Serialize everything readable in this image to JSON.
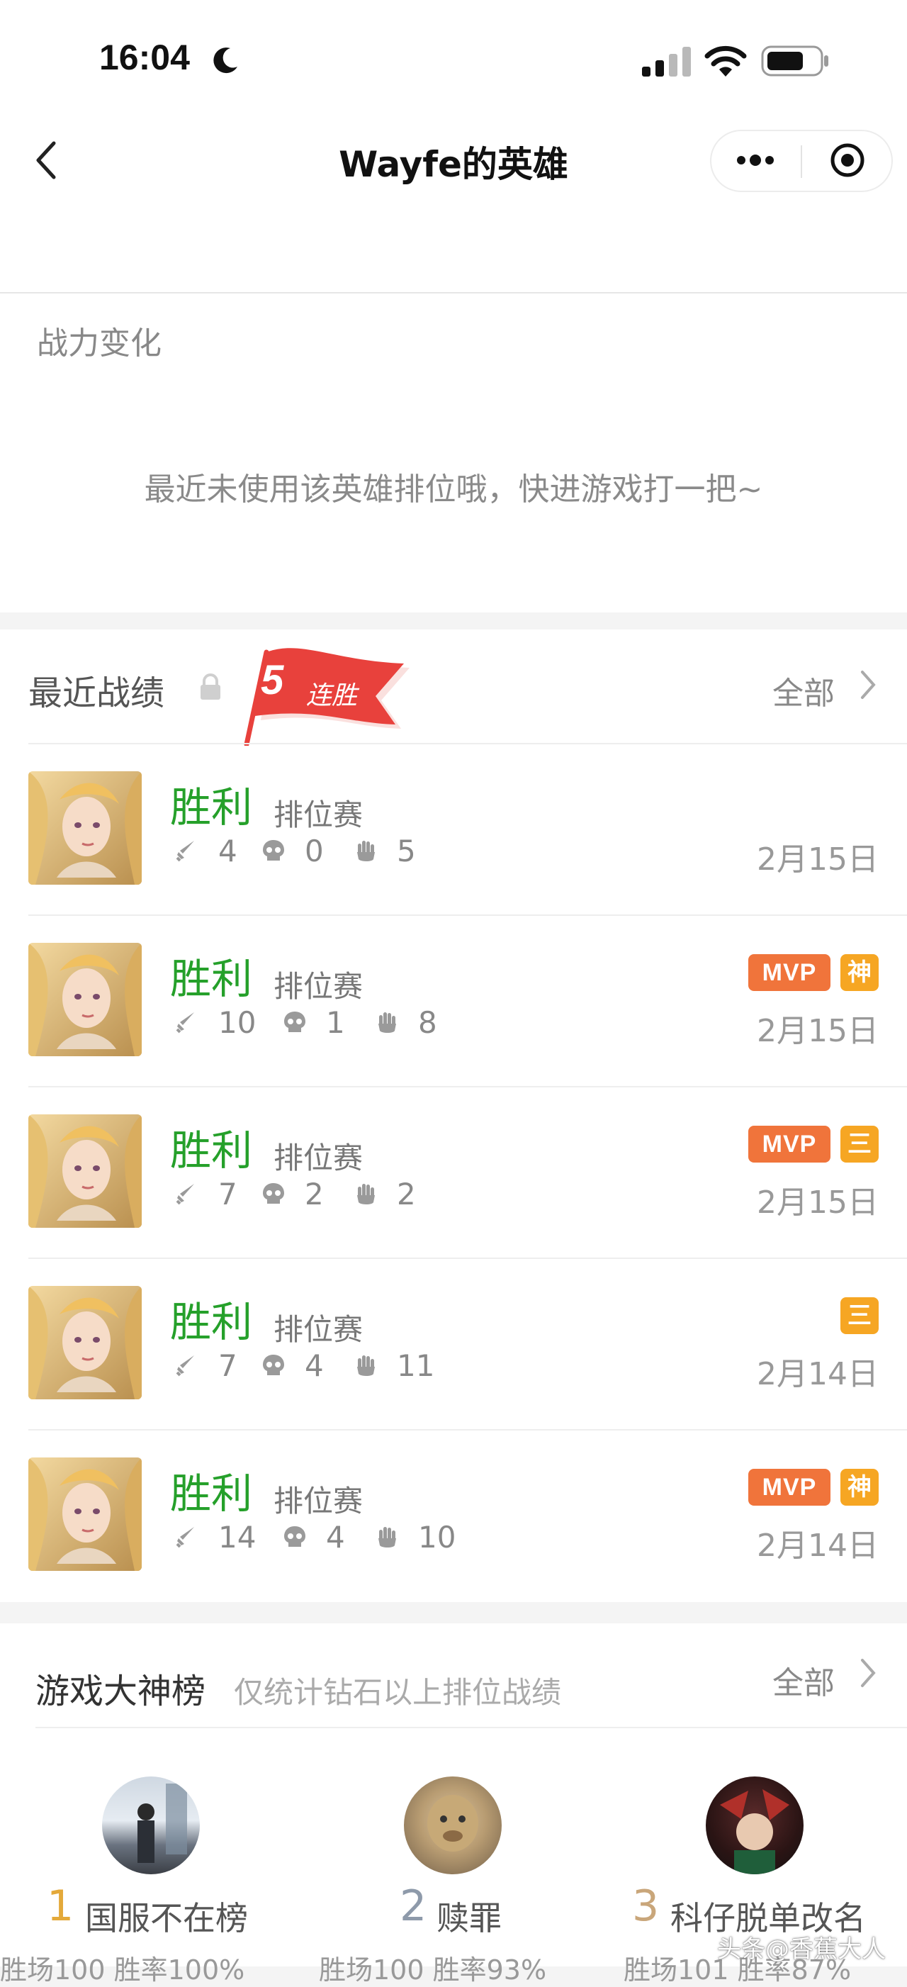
{
  "status_bar": {
    "time": "16:04"
  },
  "nav": {
    "title": "Wayfe的英雄"
  },
  "power": {
    "label": "战力变化",
    "empty_message": "最近未使用该英雄排位哦，快进游戏打一把~"
  },
  "recent": {
    "title": "最近战绩",
    "streak_count": "5",
    "streak_label": "连胜",
    "all_label": "全部",
    "matches": [
      {
        "result": "胜利",
        "mode": "排位赛",
        "kills": "4",
        "deaths": "0",
        "assists": "5",
        "date": "2月15日",
        "mvp": "",
        "tag": ""
      },
      {
        "result": "胜利",
        "mode": "排位赛",
        "kills": "10",
        "deaths": "1",
        "assists": "8",
        "date": "2月15日",
        "mvp": "MVP",
        "tag": "神"
      },
      {
        "result": "胜利",
        "mode": "排位赛",
        "kills": "7",
        "deaths": "2",
        "assists": "2",
        "date": "2月15日",
        "mvp": "MVP",
        "tag": "三"
      },
      {
        "result": "胜利",
        "mode": "排位赛",
        "kills": "7",
        "deaths": "4",
        "assists": "11",
        "date": "2月14日",
        "mvp": "",
        "tag": "三"
      },
      {
        "result": "胜利",
        "mode": "排位赛",
        "kills": "14",
        "deaths": "4",
        "assists": "10",
        "date": "2月14日",
        "mvp": "MVP",
        "tag": "神"
      }
    ]
  },
  "gods": {
    "title": "游戏大神榜",
    "subtitle": "仅统计钻石以上排位战绩",
    "all_label": "全部",
    "ranks": [
      {
        "num": "1",
        "name": "国服不在榜",
        "stats": "胜场100 胜率100%"
      },
      {
        "num": "2",
        "name": "赎罪",
        "stats": "胜场100 胜率93%"
      },
      {
        "num": "3",
        "name": "科仔脱单改名",
        "stats": "胜场101 胜率87%"
      }
    ]
  },
  "watermark": "头条@香蕉大人",
  "colors": {
    "win": "#25a02a",
    "mvp": "#f0743b",
    "tag": "#f6a623",
    "streak_flag": "#e8413c"
  }
}
